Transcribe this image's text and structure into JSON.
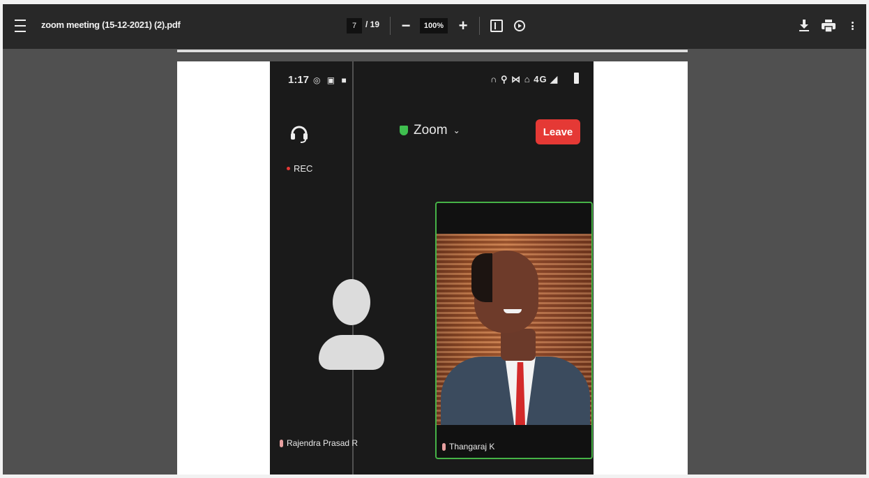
{
  "toolbar": {
    "file_name": "zoom meeting (15-12-2021) (2).pdf",
    "current_page": "7",
    "total_pages": "/ 19",
    "zoom_minus": "−",
    "zoom_level": "100%",
    "zoom_plus": "+",
    "icons": [
      "menu-icon",
      "fit-page-icon",
      "rotate-icon",
      "download-icon",
      "print-icon",
      "more-icon"
    ]
  },
  "document": {
    "page_progress": 1.0
  },
  "zoom_screen": {
    "status_time": "1:17",
    "status_right": "4G",
    "meeting_name": "Zoom",
    "leave_label": "Leave",
    "rec_label": "REC",
    "participants": [
      {
        "name": "Rajendra Prasad  R",
        "video": false
      },
      {
        "name": "Thangaraj K",
        "video": true,
        "active_speaker": true
      }
    ],
    "colors": {
      "leave": "#e53935",
      "active_border": "#46b347",
      "shield": "#3fbf4f"
    }
  }
}
